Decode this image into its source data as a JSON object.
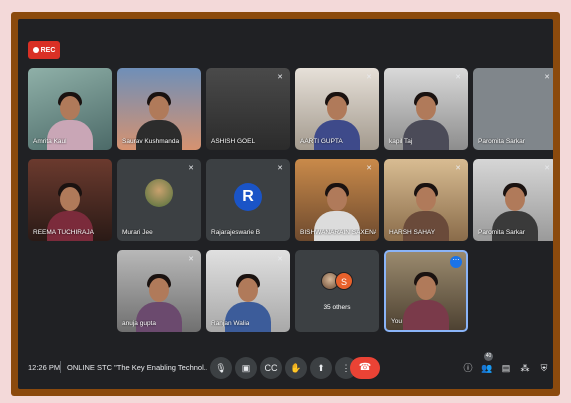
{
  "recording": {
    "label": "REC"
  },
  "participants": [
    {
      "name": "Amrita Kaul"
    },
    {
      "name": "Saurav Kushmanda"
    },
    {
      "name": "ASHISH GOEL"
    },
    {
      "name": "AARTI GUPTA"
    },
    {
      "name": "kapil Taj"
    },
    {
      "name": "Paromita Sarkar"
    },
    {
      "name": "REEMA TUCHIRAJA"
    },
    {
      "name": "Murari Jee"
    },
    {
      "name": "Rajarajeswarie B",
      "initial": "R"
    },
    {
      "name": "BISHWANARAIN SAXENA"
    },
    {
      "name": "HARSH SAHAY"
    },
    {
      "name": "Paromita Sarkar"
    },
    {
      "name": "anuja gupta"
    },
    {
      "name": "Ranjan Walia"
    },
    {
      "name": "35 others",
      "initial": "S"
    },
    {
      "name": "You"
    }
  ],
  "bottom_bar": {
    "time": "12:26 PM",
    "meeting_name": "ONLINE STC \"The Key Enabling Technol...",
    "people_badge": "40",
    "controls": [
      "mic-icon",
      "camera-icon",
      "captions-icon",
      "raise-hand-icon",
      "present-icon",
      "more-icon",
      "end-call-icon"
    ],
    "right_controls": [
      "info-icon",
      "people-icon",
      "chat-icon",
      "activities-icon",
      "host-controls-icon"
    ]
  },
  "colors": {
    "frame": "#8b4a0d",
    "screen": "#202124",
    "tile": "#3c4043",
    "end_call": "#ea4335",
    "rec": "#d93025"
  }
}
